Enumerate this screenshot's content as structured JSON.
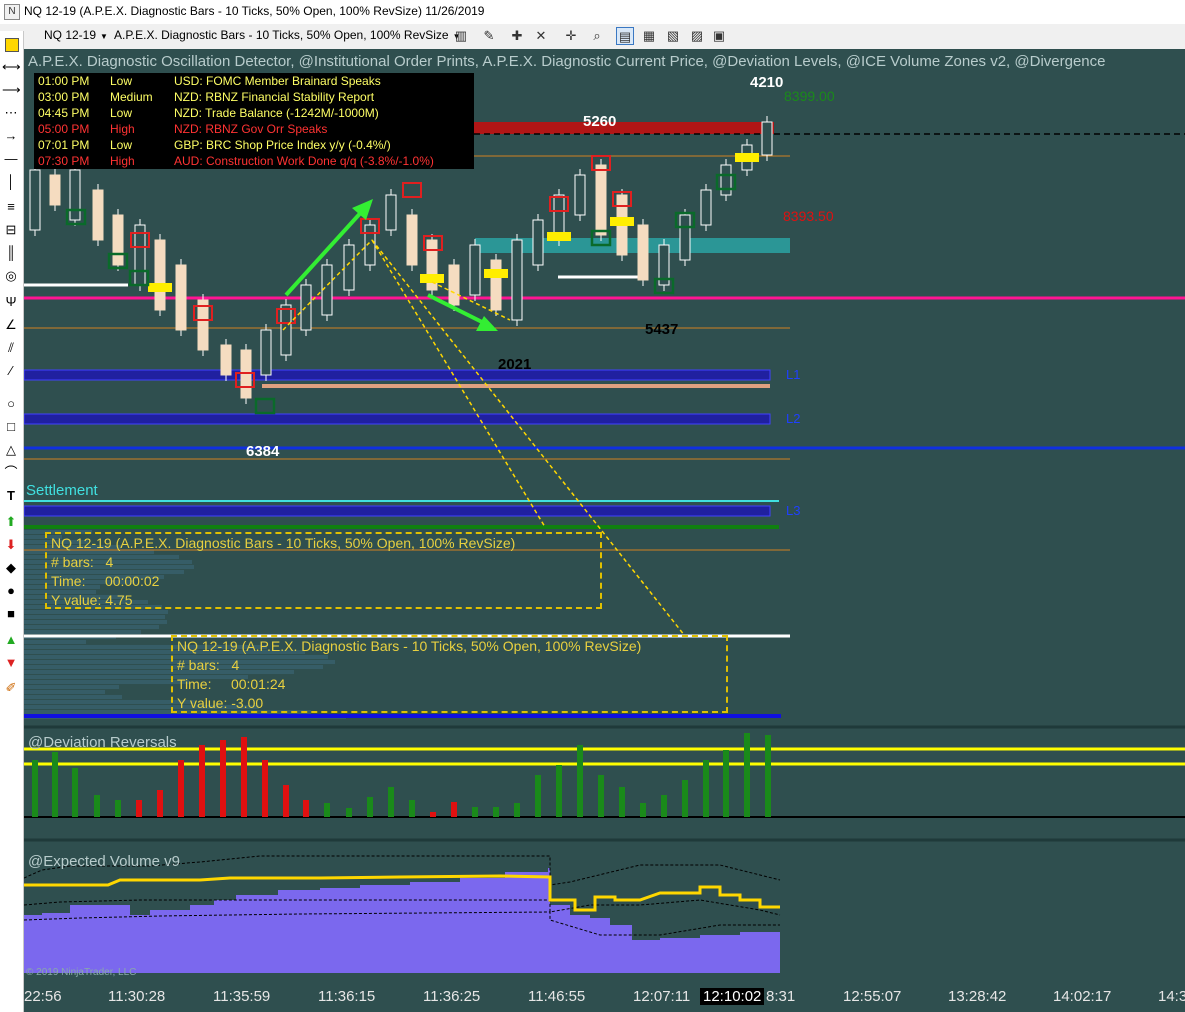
{
  "window": {
    "title": "NQ 12-19 (A.P.E.X. Diagnostic Bars - 10 Ticks, 50% Open, 100% RevSize)  11/26/2019"
  },
  "toolbar": {
    "instrument": "NQ 12-19",
    "bar_type": "A.P.E.X. Diagnostic Bars - 10 Ticks, 50% Open, 100% RevSize"
  },
  "main_pane": {
    "indicators": "A.P.E.X. Diagnostic Oscillation Detector, @Institutional Order Prints, A.P.E.X. Diagnostic Current Price, @Deviation Levels, @ICE Volume Zones v2, @Divergence",
    "labels": {
      "top_count": "4210",
      "upper_count": "5260",
      "right_count": "5437",
      "mid_count": "2021",
      "bottom_count": "6384",
      "settlement": "Settlement",
      "level_l1": "L1",
      "level_l2": "L2",
      "level_l3": "L3",
      "price_up": "8399.00",
      "price_dn": "8393.50"
    }
  },
  "news": [
    {
      "time": "01:00 PM",
      "impact": "Low",
      "event": "USD: FOMC Member Brainard Speaks",
      "color": "#ffff66"
    },
    {
      "time": "03:00 PM",
      "impact": "Medium",
      "event": "NZD: RBNZ Financial Stability Report",
      "color": "#ffff66"
    },
    {
      "time": "04:45 PM",
      "impact": "Low",
      "event": "NZD: Trade Balance (-1242M/-1000M)",
      "color": "#ffff66"
    },
    {
      "time": "05:00 PM",
      "impact": "High",
      "event": "NZD: RBNZ Gov Orr Speaks",
      "color": "#ff3333"
    },
    {
      "time": "07:01 PM",
      "impact": "Low",
      "event": "GBP: BRC Shop Price Index y/y (-0.4%/)",
      "color": "#ffff66"
    },
    {
      "time": "07:30 PM",
      "impact": "High",
      "event": "AUD: Construction Work Done q/q (-3.8%/-1.0%)",
      "color": "#ff3333"
    }
  ],
  "infoboxes": [
    {
      "title": "NQ 12-19 (A.P.E.X. Diagnostic Bars - 10 Ticks, 50% Open, 100% RevSize)",
      "bars_label": "# bars:",
      "bars": "4",
      "time_label": "Time:",
      "time": "00:00:02",
      "y_label": "Y value:",
      "y": "4.75"
    },
    {
      "title": "NQ 12-19 (A.P.E.X. Diagnostic Bars - 10 Ticks, 50% Open, 100% RevSize)",
      "bars_label": "# bars:",
      "bars": "4",
      "time_label": "Time:",
      "time": "00:01:24",
      "y_label": "Y value:",
      "y": "-3.00"
    }
  ],
  "panes": {
    "deviation": "@Deviation Reversals",
    "volume": "@Expected Volume v9"
  },
  "copyright": "© 2019 NinjaTrader, LLC",
  "xaxis": {
    "ticks": [
      "22:56",
      "11:30:28",
      "11:35:59",
      "11:36:15",
      "11:36:25",
      "11:46:55",
      "12:07:11",
      "12:10:02",
      "8:31",
      "12:55:07",
      "13:28:42",
      "14:02:17",
      "14:3"
    ],
    "highlight": "12:10:02"
  },
  "colors": {
    "background": "#2f4f4f",
    "up_candle": "#f5dcc0",
    "down_candle": "#f5dcc0",
    "bull_bar": "#1a8a1a",
    "bear_bar": "#e01010",
    "volume_fill": "#7b68ee",
    "expected_line": "#ffd700",
    "settlement": "#40e0e0",
    "magenta_line": "#ff1493"
  },
  "left_tools": [
    "yellow-square-icon",
    "arrow-left-right-icon",
    "line-arrow-icon",
    "dotted-line-icon",
    "arrow-right-icon",
    "horizontal-line-icon",
    "vertical-line-icon",
    "fib-lines-icon",
    "fib-ext-icon",
    "gann-lines-icon",
    "circle-target-icon",
    "pitchfork-icon",
    "angle-icon",
    "channel-icon",
    "double-line-icon",
    "ellipse-icon",
    "rectangle-icon",
    "triangle-icon",
    "arc-icon",
    "text-icon",
    "arrow-up-green-icon",
    "arrow-down-red-icon",
    "diamond-icon",
    "dot-icon",
    "square-icon",
    "triangle-up-green-icon",
    "triangle-down-red-icon",
    "ruler-icon"
  ]
}
